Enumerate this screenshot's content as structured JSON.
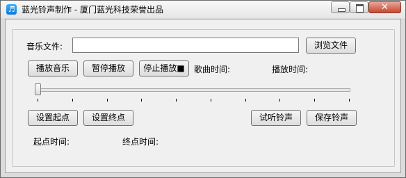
{
  "window": {
    "title": "蓝光铃声制作 - 厦门蓝光科技荣誉出品",
    "app_icon_glyph": "♬",
    "close_glyph": "✕"
  },
  "file": {
    "label": "音乐文件:",
    "value": "",
    "placeholder": "",
    "browse_label": "浏览文件"
  },
  "controls": {
    "play_label": "播放音乐",
    "pause_label": "暂停播放",
    "stop_label": "停止播放■",
    "song_time_label": "歌曲时间:",
    "play_time_label": "播放时间:"
  },
  "slider": {
    "position": 0.0,
    "tick_count": 10
  },
  "actions": {
    "set_start_label": "设置起点",
    "set_end_label": "设置终点",
    "preview_label": "试听铃声",
    "save_label": "保存铃声"
  },
  "times": {
    "start_time_label": "起点时间:",
    "end_time_label": "终点时间:"
  }
}
